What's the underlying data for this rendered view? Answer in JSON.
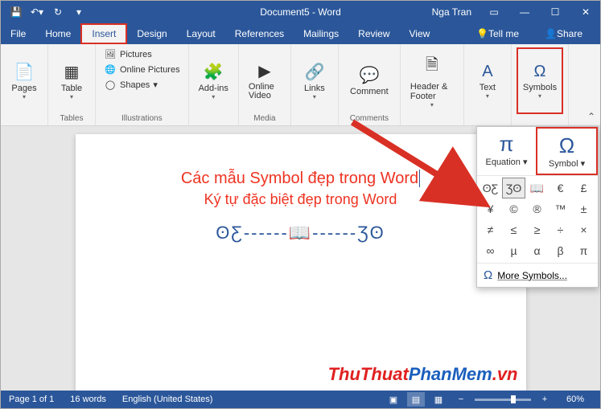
{
  "titlebar": {
    "title": "Document5 - Word",
    "user": "Nga Tran"
  },
  "tabs": {
    "file": "File",
    "home": "Home",
    "insert": "Insert",
    "design": "Design",
    "layout": "Layout",
    "references": "References",
    "mailings": "Mailings",
    "review": "Review",
    "view": "View",
    "tellme": "Tell me",
    "share": "Share"
  },
  "ribbon": {
    "pages": {
      "label": "Pages",
      "group": ""
    },
    "table": {
      "label": "Table",
      "group": "Tables"
    },
    "illustrations": {
      "pictures": "Pictures",
      "online_pictures": "Online Pictures",
      "shapes": "Shapes",
      "group": "Illustrations"
    },
    "addins": {
      "label": "Add-ins"
    },
    "media": {
      "label": "Online Video",
      "group": "Media"
    },
    "links": {
      "label": "Links"
    },
    "comment": {
      "label": "Comment",
      "group": "Comments"
    },
    "header": {
      "label": "Header & Footer"
    },
    "text": {
      "label": "Text"
    },
    "symbols": {
      "label": "Symbols"
    }
  },
  "document": {
    "line1": "Các mẫu Symbol đẹp trong Word",
    "line2": "Ký tự đặc biệt đẹp trong Word",
    "deco": "ʘƸ------📖------Ʒʘ"
  },
  "symbol_panel": {
    "equation": "Equation",
    "symbol": "Symbol",
    "recent": [
      "ʘƸ",
      "Ʒʘ",
      "📖",
      "€",
      "£",
      "¥",
      "©",
      "®",
      "™",
      "±",
      "≠",
      "≤",
      "≥",
      "÷",
      "×",
      "∞",
      "µ",
      "α",
      "β",
      "π"
    ],
    "more": "More Symbols..."
  },
  "branding": {
    "t1": "ThuThuat",
    "t2": "PhanMem",
    "t3": ".vn"
  },
  "statusbar": {
    "page": "Page 1 of 1",
    "words": "16 words",
    "lang": "English (United States)",
    "zoom": "60%"
  }
}
